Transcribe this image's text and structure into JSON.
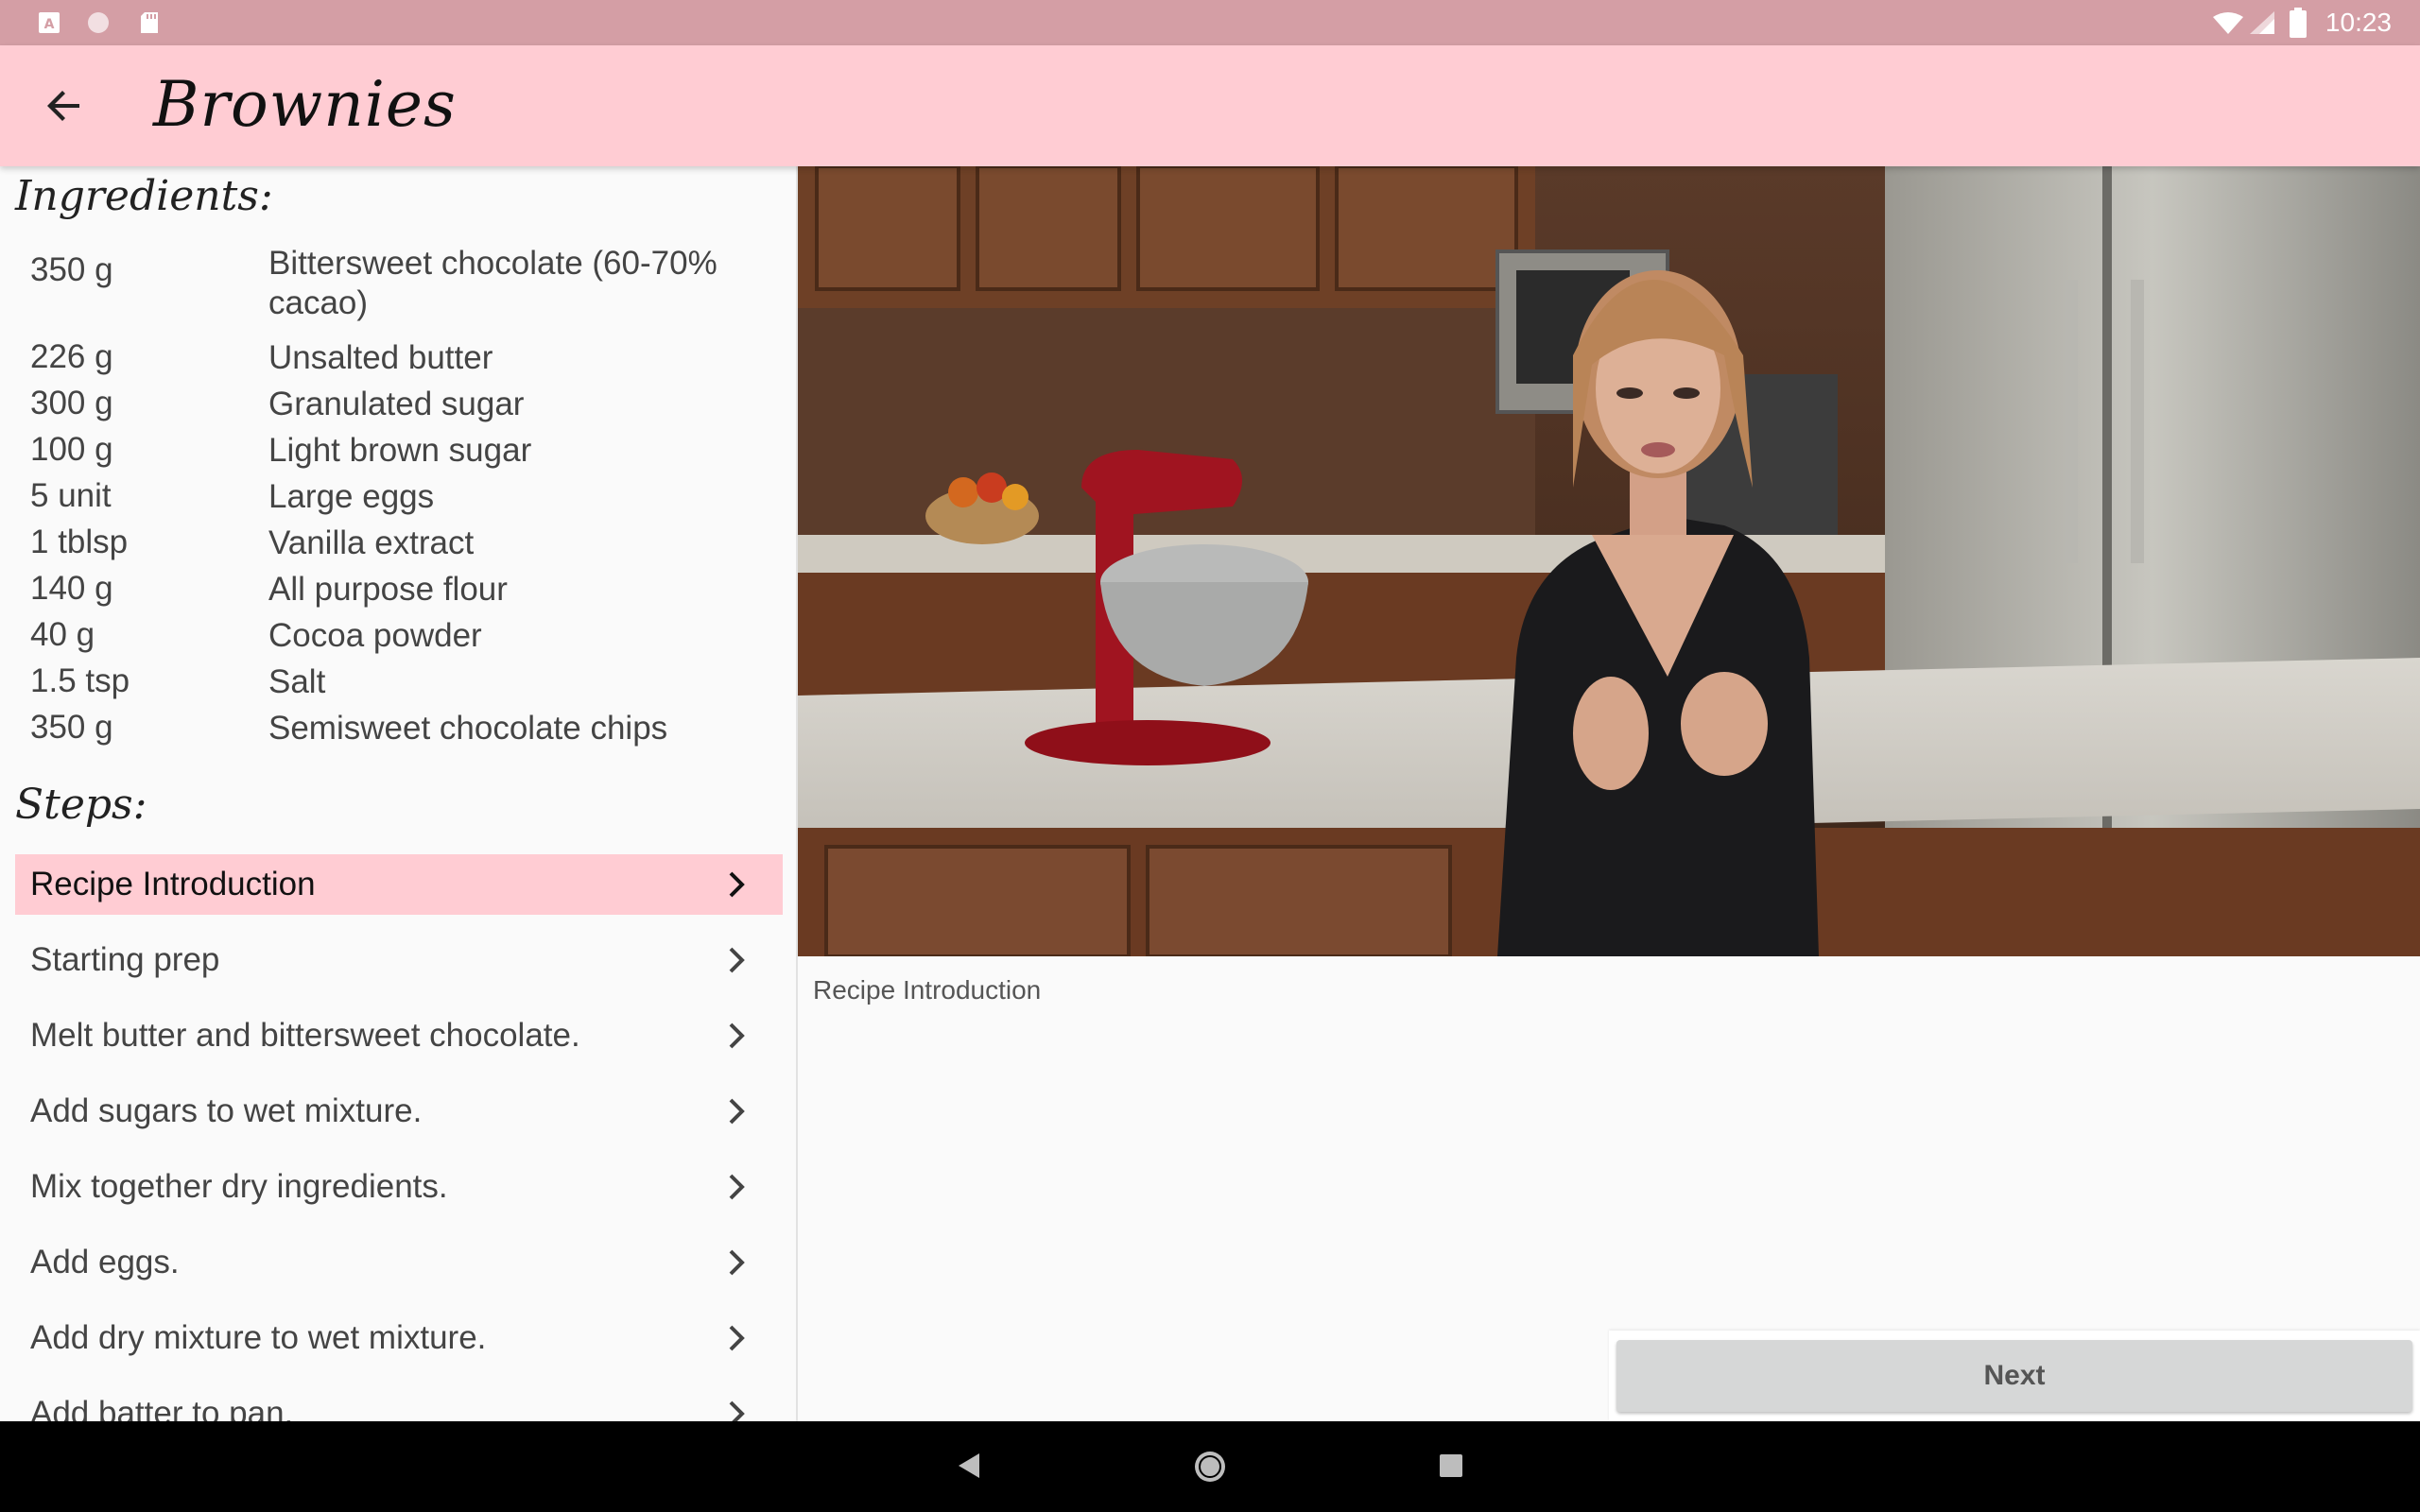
{
  "status_bar": {
    "time": "10:23",
    "left_icons": [
      "text-a-icon",
      "circle-icon",
      "sd-card-icon"
    ],
    "right_icons": [
      "wifi-icon",
      "signal-icon",
      "battery-icon"
    ],
    "background": "#d49ea5"
  },
  "app_bar": {
    "title": "Brownies",
    "back_icon": "arrow-left-icon",
    "background": "#ffccd3"
  },
  "ingredients": {
    "heading": "Ingredients:",
    "items": [
      {
        "qty": "350 g",
        "name": "Bittersweet chocolate (60-70% cacao)"
      },
      {
        "qty": "226 g",
        "name": "Unsalted butter"
      },
      {
        "qty": "300 g",
        "name": "Granulated sugar"
      },
      {
        "qty": "100 g",
        "name": "Light brown sugar"
      },
      {
        "qty": "5 unit",
        "name": "Large eggs"
      },
      {
        "qty": "1 tblsp",
        "name": "Vanilla extract"
      },
      {
        "qty": "140 g",
        "name": "All purpose flour"
      },
      {
        "qty": "40 g",
        "name": "Cocoa powder"
      },
      {
        "qty": "1.5 tsp",
        "name": "Salt"
      },
      {
        "qty": "350 g",
        "name": "Semisweet chocolate chips"
      }
    ]
  },
  "steps": {
    "heading": "Steps:",
    "selected_index": 0,
    "items": [
      {
        "label": "Recipe Introduction"
      },
      {
        "label": "Starting prep"
      },
      {
        "label": "Melt butter and bittersweet chocolate."
      },
      {
        "label": "Add sugars to wet mixture."
      },
      {
        "label": "Mix together dry ingredients."
      },
      {
        "label": "Add eggs."
      },
      {
        "label": "Add dry mixture to wet mixture."
      },
      {
        "label": "Add batter to pan."
      }
    ]
  },
  "player": {
    "caption": "Recipe Introduction"
  },
  "actions": {
    "next_label": "Next"
  },
  "nav_bar": {
    "icons": [
      "back-triangle-icon",
      "home-circle-icon",
      "recents-square-icon"
    ]
  }
}
